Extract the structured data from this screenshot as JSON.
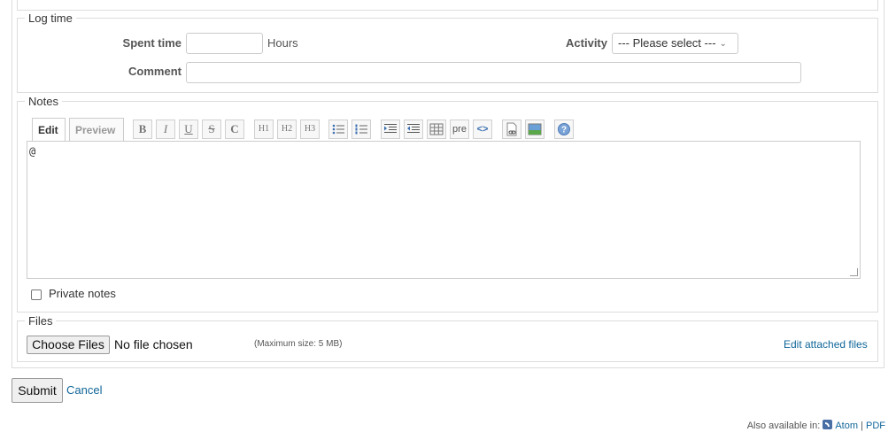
{
  "log_time": {
    "legend": "Log time",
    "spent_time_label": "Spent time",
    "spent_time_value": "",
    "hours_unit": "Hours",
    "activity_label": "Activity",
    "activity_selected": "--- Please select ---",
    "comment_label": "Comment",
    "comment_value": ""
  },
  "notes": {
    "legend": "Notes",
    "tabs": {
      "edit": "Edit",
      "preview": "Preview"
    },
    "toolbar": {
      "bold": "B",
      "italic": "I",
      "underline": "U",
      "strike": "S",
      "code": "C",
      "h1": "H1",
      "h2": "H2",
      "h3": "H3",
      "pre": "pre"
    },
    "text_value": "@",
    "private_notes_label": "Private notes",
    "private_notes_checked": false
  },
  "files": {
    "legend": "Files",
    "choose_button": "Choose Files",
    "no_file_text": "No file chosen",
    "max_size": "(Maximum size: 5 MB)",
    "edit_attached": "Edit attached files"
  },
  "actions": {
    "submit": "Submit",
    "cancel": "Cancel"
  },
  "footer": {
    "also_available": "Also available in:",
    "atom": "Atom",
    "separator": "|",
    "pdf": "PDF"
  },
  "colors": {
    "link": "#116699",
    "border": "#dddddd"
  }
}
